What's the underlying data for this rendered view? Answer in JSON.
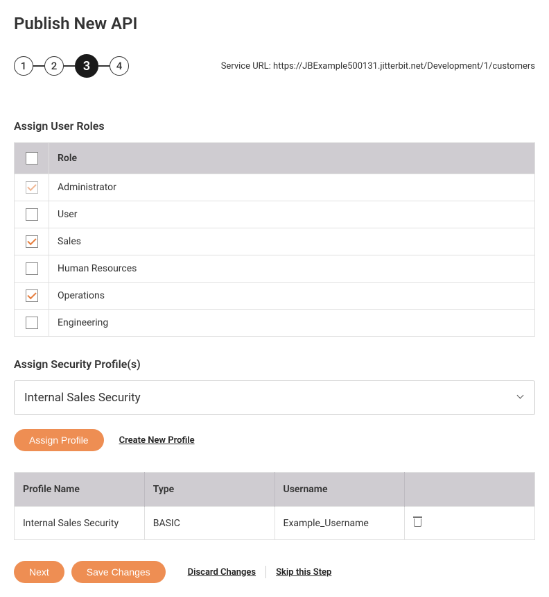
{
  "page_title": "Publish New API",
  "steps": [
    "1",
    "2",
    "3",
    "4"
  ],
  "active_step_index": 2,
  "service_url_label": "Service URL:",
  "service_url": "https://JBExample500131.jitterbit.net/Development/1/customers",
  "roles_section": {
    "title": "Assign User Roles",
    "header_role": "Role",
    "rows": [
      {
        "name": "Administrator",
        "checked": true,
        "disabled": true
      },
      {
        "name": "User",
        "checked": false,
        "disabled": false
      },
      {
        "name": "Sales",
        "checked": true,
        "disabled": false
      },
      {
        "name": "Human Resources",
        "checked": false,
        "disabled": false
      },
      {
        "name": "Operations",
        "checked": true,
        "disabled": false
      },
      {
        "name": "Engineering",
        "checked": false,
        "disabled": false
      }
    ]
  },
  "profiles_section": {
    "title": "Assign Security Profile(s)",
    "selected": "Internal Sales Security",
    "assign_button": "Assign Profile",
    "create_link": "Create New Profile",
    "headers": {
      "name": "Profile Name",
      "type": "Type",
      "username": "Username"
    },
    "rows": [
      {
        "name": "Internal Sales Security",
        "type": "BASIC",
        "username": "Example_Username"
      }
    ]
  },
  "bottom": {
    "next": "Next",
    "save": "Save Changes",
    "discard": "Discard Changes",
    "skip": "Skip this Step"
  }
}
